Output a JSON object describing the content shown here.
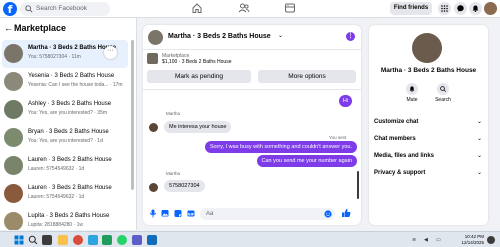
{
  "topbar": {
    "logo": "f",
    "search_placeholder": "Search Facebook",
    "find_friends": "Find friends"
  },
  "left": {
    "title": "Marketplace",
    "back": "←",
    "conversations": [
      {
        "name": "Martha · 3 Beds 2 Baths House",
        "sub": "You: 5758027304 · 11m",
        "active": true
      },
      {
        "name": "Yesenia · 3 Beds 2 Baths House",
        "sub": "Yesenia: Can I see the house toda... · 17m",
        "active": false
      },
      {
        "name": "Ashley · 3 Beds 2 Baths House",
        "sub": "You: Yes, are you interested? · 35m",
        "active": false
      },
      {
        "name": "Bryan · 3 Beds 2 Baths House",
        "sub": "You: Yes, are you interested? · 1d",
        "active": false
      },
      {
        "name": "Lauren · 3 Beds 2 Baths House",
        "sub": "Lauren: 5754549632 · 1d",
        "active": false
      },
      {
        "name": "Lauren · 3 Beds 2 Baths House",
        "sub": "Lauren: 5754549632 · 1d",
        "active": false
      },
      {
        "name": "Lupita · 3 Beds 2 Baths House",
        "sub": "Lupita: 2818884280 · 1w",
        "active": false
      }
    ]
  },
  "chat": {
    "title": "Martha · 3 Beds 2 Baths House",
    "marketplace_label": "Marketplace",
    "price_line": "$1,100 · 3 Beds 2 Baths House",
    "btn_pending": "Mark as pending",
    "btn_more": "More options",
    "hi": "Hi",
    "sender": "Martha",
    "msg_in_1": "Me interesa your house",
    "you_label": "You sent",
    "msg_out_1": "Sorry, I was busy with something and couldn't answer you.",
    "msg_out_2": "Can you send me your number again",
    "msg_in_2": "5758027304",
    "composer_placeholder": "Aa"
  },
  "right": {
    "name": "Martha · 3 Beds 2 Baths House",
    "mute": "Mute",
    "search": "Search",
    "rows": [
      "Customize chat",
      "Chat members",
      "Media, files and links",
      "Privacy & support"
    ]
  },
  "taskbar": {
    "time": "10:42 PM",
    "date": "12/14/2025"
  },
  "colors": {
    "brand": "#0866ff",
    "accent": "#7d3ce8"
  }
}
